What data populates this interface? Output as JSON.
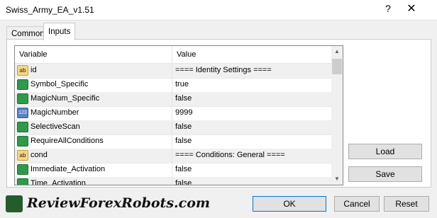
{
  "window": {
    "title": "Swiss_Army_EA_v1.51",
    "help_glyph": "?",
    "close_glyph": "✕"
  },
  "tabs": [
    {
      "label": "Common"
    },
    {
      "label": "Inputs"
    }
  ],
  "table": {
    "columns": [
      "Variable",
      "Value"
    ],
    "rows": [
      {
        "icon": "ab",
        "variable": "id",
        "value": "==== Identity Settings ===="
      },
      {
        "icon": "fn",
        "variable": "Symbol_Specific",
        "value": "true"
      },
      {
        "icon": "fn",
        "variable": "MagicNum_Specific",
        "value": "false"
      },
      {
        "icon": "123",
        "variable": "MagicNumber",
        "value": "9999"
      },
      {
        "icon": "fn",
        "variable": "SelectiveScan",
        "value": "false"
      },
      {
        "icon": "fn",
        "variable": "RequireAllConditions",
        "value": "false"
      },
      {
        "icon": "ab",
        "variable": "cond",
        "value": "==== Conditions: General ===="
      },
      {
        "icon": "fn",
        "variable": "Immediate_Activation",
        "value": "false"
      },
      {
        "icon": "fn",
        "variable": "Time_Activation",
        "value": "false"
      }
    ]
  },
  "buttons": {
    "load": "Load",
    "save": "Save",
    "ok": "OK",
    "cancel": "Cancel",
    "reset": "Reset"
  },
  "logo": {
    "text": "ReviewForexRobots.com"
  }
}
